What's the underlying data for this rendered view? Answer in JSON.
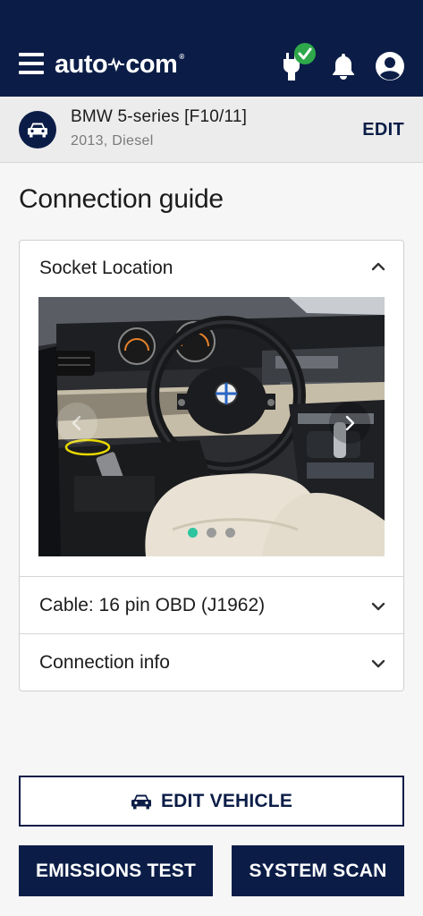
{
  "header": {
    "logo_text_left": "auto",
    "logo_text_right": "com",
    "logo_mark": "®",
    "icons": [
      "menu-icon",
      "vci-connected-icon",
      "bell-icon",
      "account-icon"
    ]
  },
  "vehicle": {
    "name": "BMW 5-series [F10/11]",
    "meta": "2013, Diesel",
    "edit_label": "EDIT"
  },
  "page": {
    "title": "Connection guide"
  },
  "accordion": {
    "socket_location": "Socket Location",
    "cable": "Cable: 16 pin OBD (J1962)",
    "connection_info": "Connection info"
  },
  "carousel": {
    "slide_count": 3,
    "active_index": 0
  },
  "actions": {
    "edit_vehicle": "EDIT VEHICLE",
    "emissions_test": "EMISSIONS TEST",
    "system_scan": "SYSTEM SCAN"
  },
  "colors": {
    "brand_navy": "#0b1d47",
    "check_green": "#2ea84a",
    "dot_active": "#2ec4a0",
    "highlight_yellow": "#e8d800"
  }
}
